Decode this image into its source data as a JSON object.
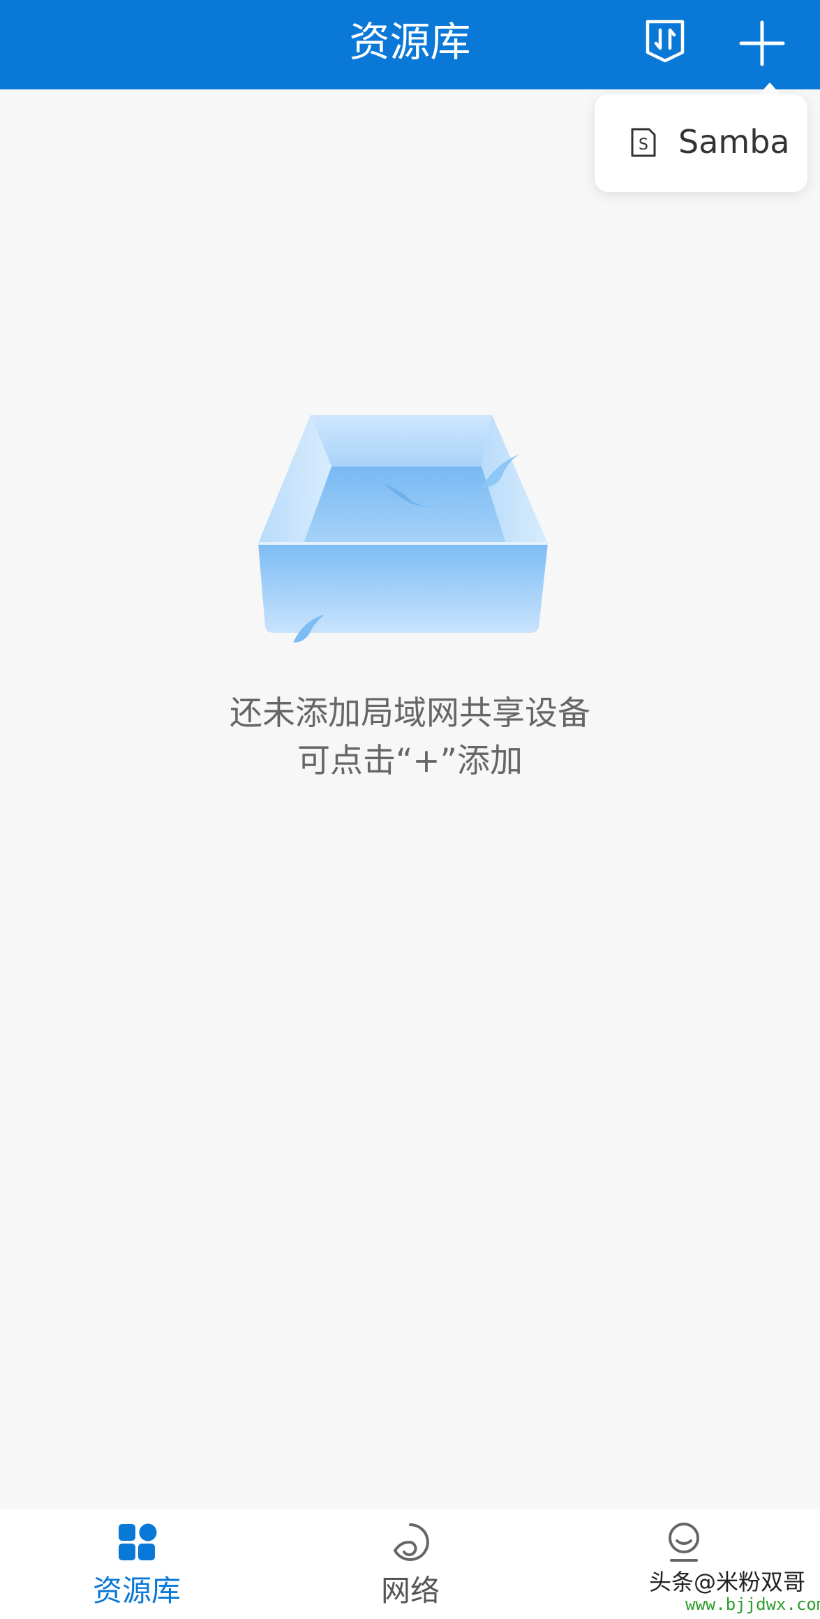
{
  "header": {
    "title": "资源库",
    "sort_icon": "sort-arrows-icon",
    "add_icon": "plus-icon",
    "background_color": "#0a78d7"
  },
  "add_menu": {
    "items": [
      {
        "icon": "samba-s-icon",
        "label": "Samba"
      }
    ]
  },
  "empty_state": {
    "illustration": "empty-box-illustration",
    "line1": "还未添加局域网共享设备",
    "line2": "可点击“+”添加"
  },
  "bottom_nav": {
    "items": [
      {
        "icon": "grid-apps-icon",
        "label": "资源库",
        "active": true
      },
      {
        "icon": "network-swirl-icon",
        "label": "网络",
        "active": false
      },
      {
        "icon": "profile-icon",
        "label": "",
        "active": false
      }
    ],
    "active_color": "#0a78d7",
    "inactive_color": "#555555"
  },
  "watermark": {
    "line1": "头条@米粉双哥",
    "line2": "www.bjjdwx.com"
  }
}
